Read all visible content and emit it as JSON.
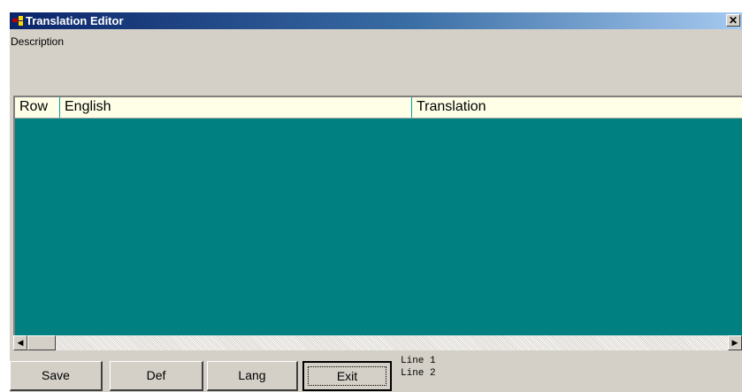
{
  "window": {
    "title": "Translation Editor",
    "close_glyph": "✕"
  },
  "description_label": "Description",
  "grid": {
    "columns": [
      "Row",
      "English",
      "Translation"
    ],
    "background": "#008080",
    "header_background": "#ffffe7"
  },
  "scrollbar": {
    "left_arrow": "◀",
    "right_arrow": "▶"
  },
  "buttons": {
    "save": "Save",
    "def": "Def",
    "lang": "Lang",
    "exit": "Exit"
  },
  "status": {
    "line1": "Line 1",
    "line2": "Line 2"
  },
  "icons": {
    "app": "app-icon",
    "close": "close-icon",
    "scroll_left": "arrow-left-icon",
    "scroll_right": "arrow-right-icon"
  }
}
